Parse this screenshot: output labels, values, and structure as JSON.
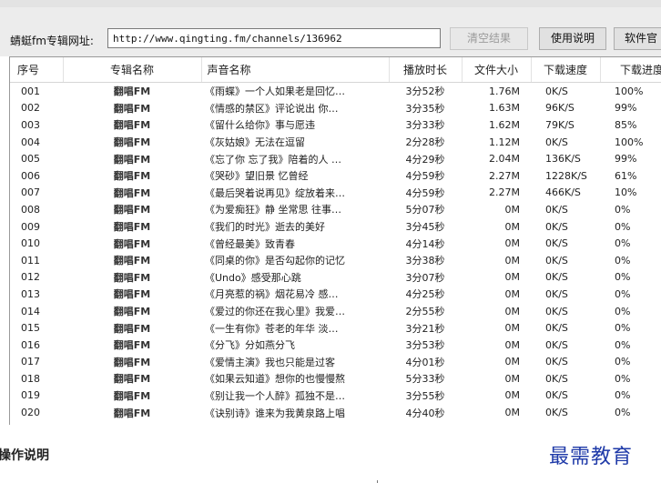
{
  "toolbar": {
    "url_label": "蜻蜓fm专辑网址:",
    "url_value": "http://www.qingting.fm/channels/136962",
    "clear_label": "清空结果",
    "help_label": "使用说明",
    "software_label": "软件官"
  },
  "table": {
    "columns": [
      "序号",
      "专辑名称",
      "声音名称",
      "播放时长",
      "文件大小",
      "下载速度",
      "下载进度"
    ],
    "rows": [
      [
        "001",
        "翻唱FM",
        "《雨蝶》一个人如果老是回忆…",
        "3分52秒",
        "1.76M",
        "0K/S",
        "100%"
      ],
      [
        "002",
        "翻唱FM",
        "《情感的禁区》评论说出 你…",
        "3分35秒",
        "1.63M",
        "96K/S",
        "99%"
      ],
      [
        "003",
        "翻唱FM",
        "《留什么给你》事与愿违",
        "3分33秒",
        "1.62M",
        "79K/S",
        "85%"
      ],
      [
        "004",
        "翻唱FM",
        "《灰姑娘》无法在逗留",
        "2分28秒",
        "1.12M",
        "0K/S",
        "100%"
      ],
      [
        "005",
        "翻唱FM",
        "《忘了你 忘了我》陪着的人 …",
        "4分29秒",
        "2.04M",
        "136K/S",
        "99%"
      ],
      [
        "006",
        "翻唱FM",
        "《哭砂》望旧景 忆曾经",
        "4分59秒",
        "2.27M",
        "1228K/S",
        "61%"
      ],
      [
        "007",
        "翻唱FM",
        "《最后哭着说再见》绽放着来…",
        "4分59秒",
        "2.27M",
        "466K/S",
        "10%"
      ],
      [
        "008",
        "翻唱FM",
        "《为爱痴狂》静 坐常思 往事…",
        "5分07秒",
        "0M",
        "0K/S",
        "0%"
      ],
      [
        "009",
        "翻唱FM",
        "《我们的时光》逝去的美好",
        "3分45秒",
        "0M",
        "0K/S",
        "0%"
      ],
      [
        "010",
        "翻唱FM",
        "《曾经最美》致青春",
        "4分14秒",
        "0M",
        "0K/S",
        "0%"
      ],
      [
        "011",
        "翻唱FM",
        "《同桌的你》是否勾起你的记忆",
        "3分38秒",
        "0M",
        "0K/S",
        "0%"
      ],
      [
        "012",
        "翻唱FM",
        "《Undo》感受那心跳",
        "3分07秒",
        "0M",
        "0K/S",
        "0%"
      ],
      [
        "013",
        "翻唱FM",
        "《月亮惹的祸》烟花易冷 感…",
        "4分25秒",
        "0M",
        "0K/S",
        "0%"
      ],
      [
        "014",
        "翻唱FM",
        "《爱过的你还在我心里》我爱…",
        "2分55秒",
        "0M",
        "0K/S",
        "0%"
      ],
      [
        "015",
        "翻唱FM",
        "《一生有你》苍老的年华 淡…",
        "3分21秒",
        "0M",
        "0K/S",
        "0%"
      ],
      [
        "016",
        "翻唱FM",
        "《分飞》分如燕分飞",
        "3分53秒",
        "0M",
        "0K/S",
        "0%"
      ],
      [
        "017",
        "翻唱FM",
        "《爱情主演》我也只能是过客",
        "4分01秒",
        "0M",
        "0K/S",
        "0%"
      ],
      [
        "018",
        "翻唱FM",
        "《如果云知道》想你的也慢慢熬",
        "5分33秒",
        "0M",
        "0K/S",
        "0%"
      ],
      [
        "019",
        "翻唱FM",
        "《别让我一个人醉》孤独不是…",
        "3分55秒",
        "0M",
        "0K/S",
        "0%"
      ],
      [
        "020",
        "翻唱FM",
        "《诀别诗》谁来为我黄泉路上唱",
        "4分40秒",
        "0M",
        "0K/S",
        "0%"
      ]
    ]
  },
  "footer": {
    "section_title": "操作说明",
    "brand": "最需教育"
  }
}
